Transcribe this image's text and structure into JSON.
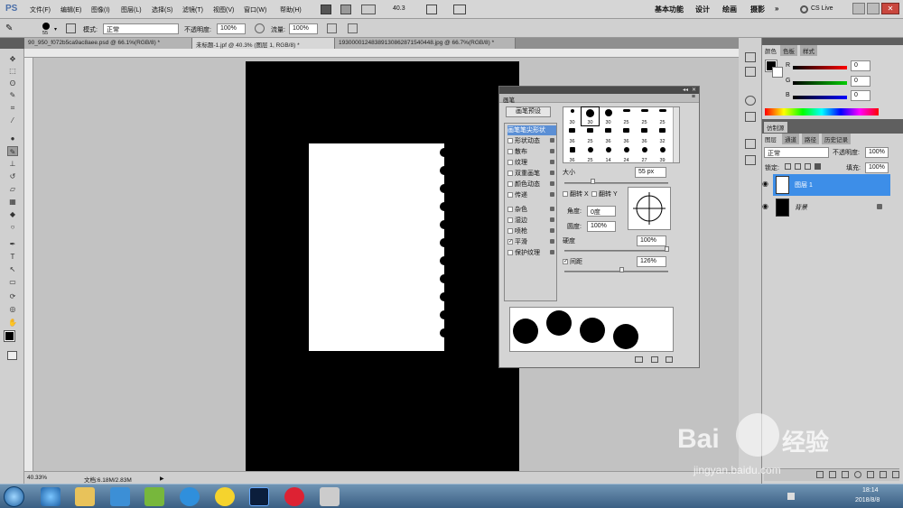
{
  "menubar": {
    "app_logo": "PS",
    "items": [
      "文件(F)",
      "编辑(E)",
      "图像(I)",
      "图层(L)",
      "选择(S)",
      "滤镜(T)",
      "视图(V)",
      "窗口(W)",
      "帮助(H)"
    ],
    "zoom": "40.3",
    "workspaces": [
      "基本功能",
      "设计",
      "绘画",
      "摄影"
    ],
    "more": "»",
    "cslive": "CS Live"
  },
  "options": {
    "brush_size": "55",
    "mode_label": "模式:",
    "mode_value": "正常",
    "opacity_label": "不透明度:",
    "opacity_value": "100%",
    "flow_label": "流量:",
    "flow_value": "100%"
  },
  "tabs": [
    "90_950_f072b5ca9ac8aee.psd @ 66.1%(RGB/8) *",
    "未标题-1.jpf @ 40.3% (图层 1, RGB/8) *",
    "1930000124838913086287154044​8.jpg @ 66.7%(RGB/8) *"
  ],
  "status": {
    "zoom": "40.33%",
    "doc": "文档:6.18M/2.83M"
  },
  "brush_panel": {
    "title": "画笔",
    "preset_button": "画笔预设",
    "options": [
      {
        "label": "画笔笔尖形状",
        "checked": false,
        "active": true
      },
      {
        "label": "形状动态",
        "checked": false
      },
      {
        "label": "散布",
        "checked": false
      },
      {
        "label": "纹理",
        "checked": false
      },
      {
        "label": "双重画笔",
        "checked": false
      },
      {
        "label": "颜色动态",
        "checked": false
      },
      {
        "label": "传递",
        "checked": false
      },
      {
        "label": "杂色",
        "checked": false
      },
      {
        "label": "湿边",
        "checked": false
      },
      {
        "label": "喷枪",
        "checked": false
      },
      {
        "label": "平滑",
        "checked": true
      },
      {
        "label": "保护纹理",
        "checked": false
      }
    ],
    "tips": [
      "30",
      "30",
      "30",
      "25",
      "25",
      "25",
      "36",
      "25",
      "36",
      "36",
      "36",
      "32",
      "36",
      "25",
      "14",
      "24",
      "27",
      "39",
      "46"
    ],
    "size_label": "大小",
    "size_value": "55 px",
    "flip_x": "翻转 X",
    "flip_y": "翻转 Y",
    "angle_label": "角度:",
    "angle_value": "0度",
    "roundness_label": "圆度:",
    "roundness_value": "100%",
    "hardness_label": "硬度",
    "hardness_value": "100%",
    "spacing_label": "间距",
    "spacing_value": "126%"
  },
  "color_panel": {
    "tabs": [
      "颜色",
      "色板",
      "样式"
    ],
    "channels": [
      {
        "name": "R",
        "value": "0"
      },
      {
        "name": "G",
        "value": "0"
      },
      {
        "name": "B",
        "value": "0"
      }
    ]
  },
  "adjust_tab": "仿制源",
  "layers_panel": {
    "tabs": [
      "图层",
      "通道",
      "路径",
      "历史记录"
    ],
    "blend": "正常",
    "opacity_label": "不透明度:",
    "opacity_value": "100%",
    "lock_label": "锁定:",
    "fill_label": "填充:",
    "fill_value": "100%",
    "layers": [
      {
        "name": "图层 1",
        "selected": true
      },
      {
        "name": "背景",
        "selected": false
      }
    ]
  },
  "taskbar": {
    "time": "18:14",
    "date": "2018/8/8"
  },
  "watermark": {
    "brand": "Bai",
    "brand2": "经验",
    "url": "jingyan.baidu.com"
  }
}
